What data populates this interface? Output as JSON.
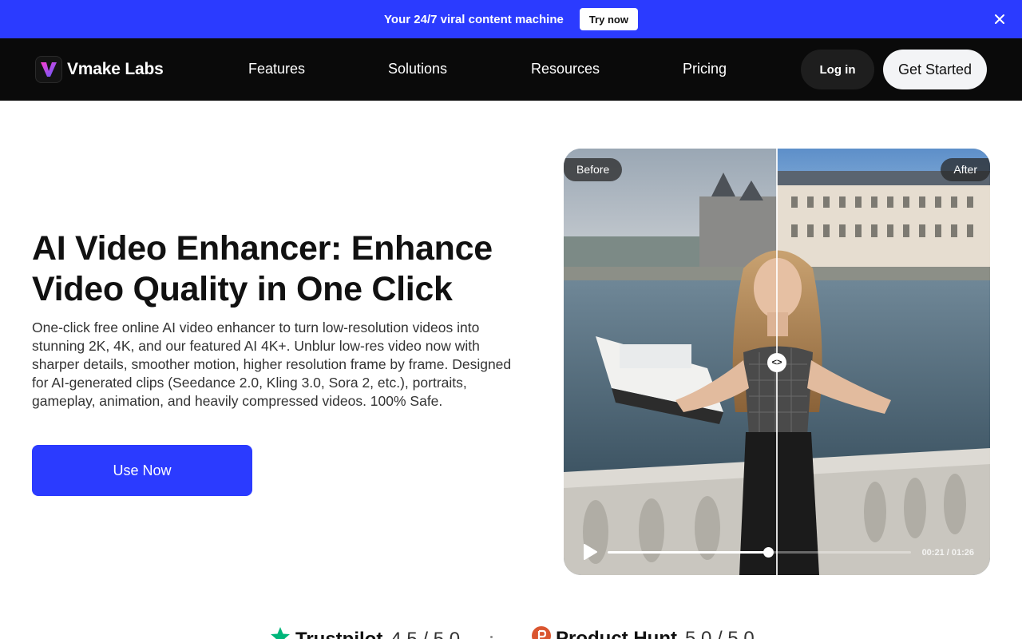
{
  "promo": {
    "text": "Your 24/7 viral content machine",
    "cta": "Try now",
    "close_icon": "close-icon"
  },
  "nav": {
    "brand": "Vmake Labs",
    "items": [
      {
        "label": "Features"
      },
      {
        "label": "Solutions"
      },
      {
        "label": "Resources"
      },
      {
        "label": "Pricing"
      }
    ],
    "login": "Log in",
    "get_started": "Get Started"
  },
  "hero": {
    "title": "AI Video Enhancer: Enhance Video Quality in One Click",
    "description": "One-click free online AI video enhancer to turn low-resolution videos into stunning 2K, 4K, and our featured AI 4K+. Unblur low-res video now with sharper details, smoother motion, higher resolution frame by frame. Designed for AI-generated clips (Seedance 2.0, Kling 3.0, Sora 2, etc.), portraits, gameplay, animation, and heavily compressed videos. 100% Safe.",
    "cta": "Use Now"
  },
  "compare": {
    "before_label": "Before",
    "after_label": "After",
    "handle_glyph": "<>",
    "time": "00:21 / 01:26",
    "progress": 0.53
  },
  "ratings": [
    {
      "brand": "Trustpilot",
      "score": "4.5 / 5.0",
      "icon": "trustpilot-star-icon",
      "color": "#00b67a"
    },
    {
      "brand": "Product Hunt",
      "score": "5.0 / 5.0",
      "icon": "product-hunt-icon",
      "color": "#da552f"
    }
  ],
  "colors": {
    "accent": "#2b3bff",
    "nav_bg": "#0a0a0a"
  }
}
